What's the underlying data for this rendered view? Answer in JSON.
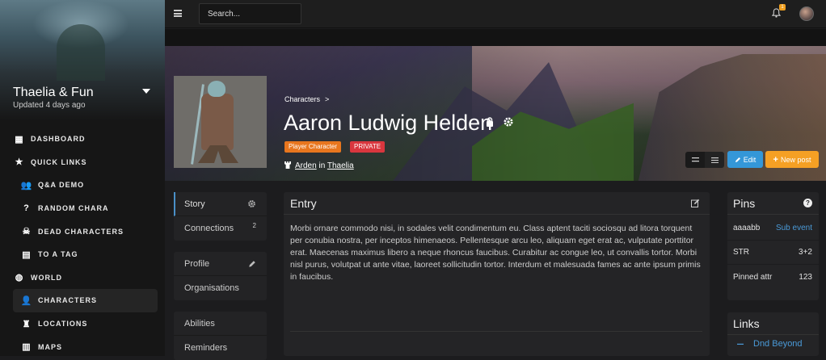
{
  "campaign": {
    "title": "Thaelia & Fun",
    "updated": "Updated 4 days ago"
  },
  "nav": [
    {
      "label": "DASHBOARD",
      "icon": "dashboard-icon",
      "level": 1
    },
    {
      "label": "QUICK LINKS",
      "icon": "star-icon",
      "level": 1
    },
    {
      "label": "Q&A DEMO",
      "icon": "users-icon",
      "level": 2
    },
    {
      "label": "RANDOM CHARA",
      "icon": "question-icon",
      "level": 2
    },
    {
      "label": "DEAD CHARACTERS",
      "icon": "skull-icon",
      "level": 2
    },
    {
      "label": "TO A TAG",
      "icon": "table-icon",
      "level": 2
    },
    {
      "label": "WORLD",
      "icon": "globe-icon",
      "level": 1
    },
    {
      "label": "CHARACTERS",
      "icon": "user-icon",
      "level": 2,
      "active": true
    },
    {
      "label": "LOCATIONS",
      "icon": "castle-icon",
      "level": 2
    },
    {
      "label": "MAPS",
      "icon": "map-icon",
      "level": 2
    }
  ],
  "topbar": {
    "search_placeholder": "Search...",
    "notification_count": "1"
  },
  "header": {
    "breadcrumb": "Characters",
    "breadcrumb_sep": ">",
    "name": "Aaron Ludwig Helden",
    "tags": [
      "Player Character",
      "PRIVATE"
    ],
    "location": "Arden",
    "location_in": "in",
    "world": "Thaelia"
  },
  "actions": {
    "edit": "Edit",
    "new_post": "New post"
  },
  "menu": {
    "group1": [
      {
        "label": "Story",
        "active": true
      },
      {
        "label": "Connections",
        "count": "2"
      }
    ],
    "group2": [
      {
        "label": "Profile"
      },
      {
        "label": "Organisations"
      }
    ],
    "group3": [
      {
        "label": "Abilities"
      },
      {
        "label": "Reminders"
      }
    ]
  },
  "entry": {
    "title": "Entry",
    "body": "Morbi ornare commodo nisi, in sodales velit condimentum eu. Class aptent taciti sociosqu ad litora torquent per conubia nostra, per inceptos himenaeos. Pellentesque arcu leo, aliquam eget erat ac, vulputate porttitor erat. Maecenas maximus libero a neque rhoncus faucibus. Curabitur ac congue leo, ut convallis tortor. Morbi nisl purus, volutpat ut ante vitae, laoreet sollicitudin tortor. Interdum et malesuada fames ac ante ipsum primis in faucibus."
  },
  "pins": {
    "title": "Pins",
    "rows": [
      {
        "label": "aaaabb",
        "value": "Sub event"
      },
      {
        "label": "STR",
        "value": "3+2"
      },
      {
        "label": "Pinned attr",
        "value": "123"
      }
    ]
  },
  "links": {
    "title": "Links",
    "item": "Dnd Beyond"
  }
}
